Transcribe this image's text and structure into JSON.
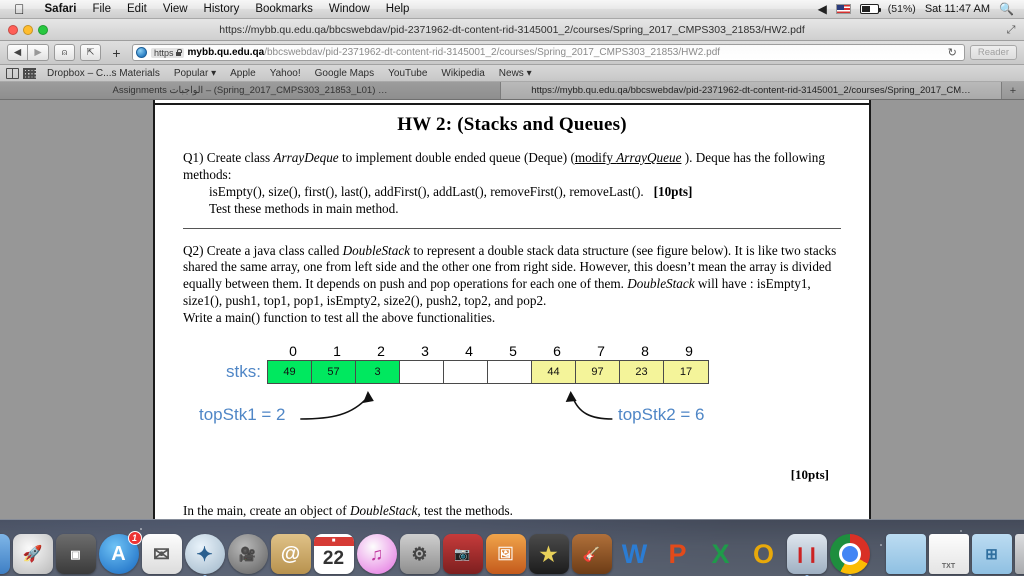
{
  "menubar": {
    "apple_icon": "apple-icon",
    "items": [
      {
        "label": "Safari",
        "bold": true
      },
      {
        "label": "File",
        "bold": false
      },
      {
        "label": "Edit",
        "bold": false
      },
      {
        "label": "View",
        "bold": false
      },
      {
        "label": "History",
        "bold": false
      },
      {
        "label": "Bookmarks",
        "bold": false
      },
      {
        "label": "Window",
        "bold": false
      },
      {
        "label": "Help",
        "bold": false
      }
    ],
    "status": {
      "volume_icon": "volume-mute-icon",
      "input_flag": "us-flag-icon",
      "battery_icon": "battery-icon",
      "battery_percent": "(51%)",
      "clock": "Sat 11:47 AM",
      "spotlight_icon": "search-icon"
    }
  },
  "window": {
    "title": "https://mybb.qu.edu.qa/bbcswebdav/pid-2371962-dt-content-rid-3145001_2/courses/Spring_2017_CMPS303_21853/HW2.pdf",
    "close_color": "#ff5f57",
    "minimize_color": "#ffbd2e",
    "zoom_color": "#28c840",
    "fullscreen_icon": "fullscreen-icon"
  },
  "toolbar": {
    "back_icon": "back-arrow-icon",
    "forward_icon": "forward-arrow-icon",
    "share_icon": "share-icon",
    "export_icon": "export-icon",
    "add_tab_label": "+",
    "site_icon": "globe-icon",
    "https_label": "https",
    "lock_icon": "lock-icon",
    "url_domain": "mybb.qu.edu.qa",
    "url_path": "/bbcswebdav/pid-2371962-dt-content-rid-3145001_2/courses/Spring_2017_CMPS303_21853/HW2.pdf",
    "reload_icon": "reload-icon",
    "reader_label": "Reader"
  },
  "bookmarks_bar": {
    "sidebar_icon": "bookmarks-sidebar-icon",
    "topsites_icon": "top-sites-grid-icon",
    "items": [
      {
        "label": "Dropbox – C...s Materials",
        "has_chevron": false
      },
      {
        "label": "Popular",
        "has_chevron": true
      },
      {
        "label": "Apple",
        "has_chevron": false
      },
      {
        "label": "Yahoo!",
        "has_chevron": false
      },
      {
        "label": "Google Maps",
        "has_chevron": false
      },
      {
        "label": "YouTube",
        "has_chevron": false
      },
      {
        "label": "Wikipedia",
        "has_chevron": false
      },
      {
        "label": "News",
        "has_chevron": true
      }
    ]
  },
  "tabs": {
    "items": [
      {
        "label": "Assignments الواجبات – (Spring_2017_CMPS303_21853_L01) …",
        "active": false
      },
      {
        "label": "https://mybb.qu.edu.qa/bbcswebdav/pid-2371962-dt-content-rid-3145001_2/courses/Spring_2017_CM…",
        "active": true
      }
    ],
    "new_tab_label": "+"
  },
  "document": {
    "heading": "HW 2: (Stacks and Queues)",
    "q1": {
      "line1_a": "Q1)  Create class ",
      "line1_italic1": "ArrayDeque",
      "line1_b": " to implement double ended queue (Deque) (",
      "line1_underline_a": "modify ",
      "line1_underline_italic": "ArrayQueue",
      "line1_c": " ). Deque has the following methods:",
      "methods": "isEmpty(), size(), first(), last(), addFirst(), addLast(), removeFirst(), removeLast().",
      "points": "[10pts]",
      "test_line": "Test these methods in main method."
    },
    "q2": {
      "line_a": "Q2) Create a java class called  ",
      "italic1": "DoubleStack",
      "line_b": " to represent a double stack data structure (see figure below). It is like two stacks shared the same array, one from left side and the other one from right side. However, this doesn’t mean the array is divided equally between them. It depends on push and pop operations for each one of them.  ",
      "italic2": "DoubleStack",
      "line_c": " will have :  isEmpty1, size1(), push1, top1, pop1, isEmpty2, size2(), push2, top2, and pop2.",
      "line_d": "Write a main() function to test all the above functionalities.",
      "points": "[10pts]",
      "closing_a": "In the main, create an object of ",
      "closing_italic": "DoubleStack",
      "closing_b": ",  test the methods."
    },
    "figure": {
      "array_label": "stks:",
      "indices": [
        "0",
        "1",
        "2",
        "3",
        "4",
        "5",
        "6",
        "7",
        "8",
        "9"
      ],
      "cells": [
        {
          "value": "49",
          "fill": "#00e85f"
        },
        {
          "value": "57",
          "fill": "#00e85f"
        },
        {
          "value": "3",
          "fill": "#00e85f"
        },
        {
          "value": "",
          "fill": "#ffffff"
        },
        {
          "value": "",
          "fill": "#ffffff"
        },
        {
          "value": "",
          "fill": "#ffffff"
        },
        {
          "value": "44",
          "fill": "#f4f49a"
        },
        {
          "value": "97",
          "fill": "#f4f49a"
        },
        {
          "value": "23",
          "fill": "#f4f49a"
        },
        {
          "value": "17",
          "fill": "#f4f49a"
        }
      ],
      "top_stack_1": "topStk1 = 2",
      "top_stack_2": "topStk2 = 6",
      "label_color": "#4f86c6",
      "stack1_color": "#00e85f",
      "stack2_color": "#f4f49a"
    }
  },
  "dock": {
    "items": [
      {
        "name": "finder",
        "glyph": "",
        "cls": "d-finder",
        "running": true
      },
      {
        "name": "launchpad",
        "glyph": "",
        "cls": "d-launch",
        "running": false
      },
      {
        "name": "mission-control",
        "glyph": "",
        "cls": "d-mission",
        "running": false
      },
      {
        "name": "app-store",
        "glyph": "A",
        "cls": "d-appstore",
        "badge": "1",
        "running": false
      },
      {
        "name": "mail",
        "glyph": "✉",
        "cls": "d-mail",
        "running": false
      },
      {
        "name": "safari",
        "glyph": "✦",
        "cls": "d-safari",
        "running": true
      },
      {
        "name": "facetime",
        "glyph": "",
        "cls": "d-facetime",
        "running": false
      },
      {
        "name": "contacts",
        "glyph": "@",
        "cls": "d-contacts",
        "running": false
      },
      {
        "name": "calendar",
        "glyph": "22",
        "cls": "d-calendar",
        "running": false
      },
      {
        "name": "itunes",
        "glyph": "♪",
        "cls": "d-itunes",
        "running": false
      },
      {
        "name": "system-preferences",
        "glyph": "⚙",
        "cls": "d-sysprefs",
        "running": false
      },
      {
        "name": "photo-booth",
        "glyph": "",
        "cls": "d-photobooth",
        "running": false
      },
      {
        "name": "iphoto",
        "glyph": "",
        "cls": "d-iphoto",
        "running": false
      },
      {
        "name": "imovie",
        "glyph": "★",
        "cls": "d-imovie",
        "running": false
      },
      {
        "name": "garageband",
        "glyph": "",
        "cls": "d-garageband",
        "running": false
      },
      {
        "name": "microsoft-word",
        "glyph": "W",
        "cls": "d-word",
        "running": false
      },
      {
        "name": "microsoft-powerpoint",
        "glyph": "P",
        "cls": "d-ppt",
        "running": false
      },
      {
        "name": "microsoft-excel",
        "glyph": "X",
        "cls": "d-excel",
        "running": false
      },
      {
        "name": "microsoft-outlook",
        "glyph": "O",
        "cls": "d-outlook",
        "running": false
      },
      {
        "name": "parallels-desktop",
        "glyph": "❙❙",
        "cls": "d-parallels",
        "running": true
      },
      {
        "name": "google-chrome",
        "glyph": "",
        "cls": "d-chrome",
        "running": true
      }
    ],
    "right_items": [
      {
        "name": "downloads-folder",
        "glyph": "",
        "cls": "d-folder",
        "label": ""
      },
      {
        "name": "text-document",
        "glyph": "TXT",
        "cls": "d-txt",
        "label": "TXT"
      },
      {
        "name": "windows-folder",
        "glyph": "⊞",
        "cls": "d-winfolder",
        "label": ""
      },
      {
        "name": "trash",
        "glyph": "",
        "cls": "d-trash",
        "label": ""
      }
    ]
  }
}
